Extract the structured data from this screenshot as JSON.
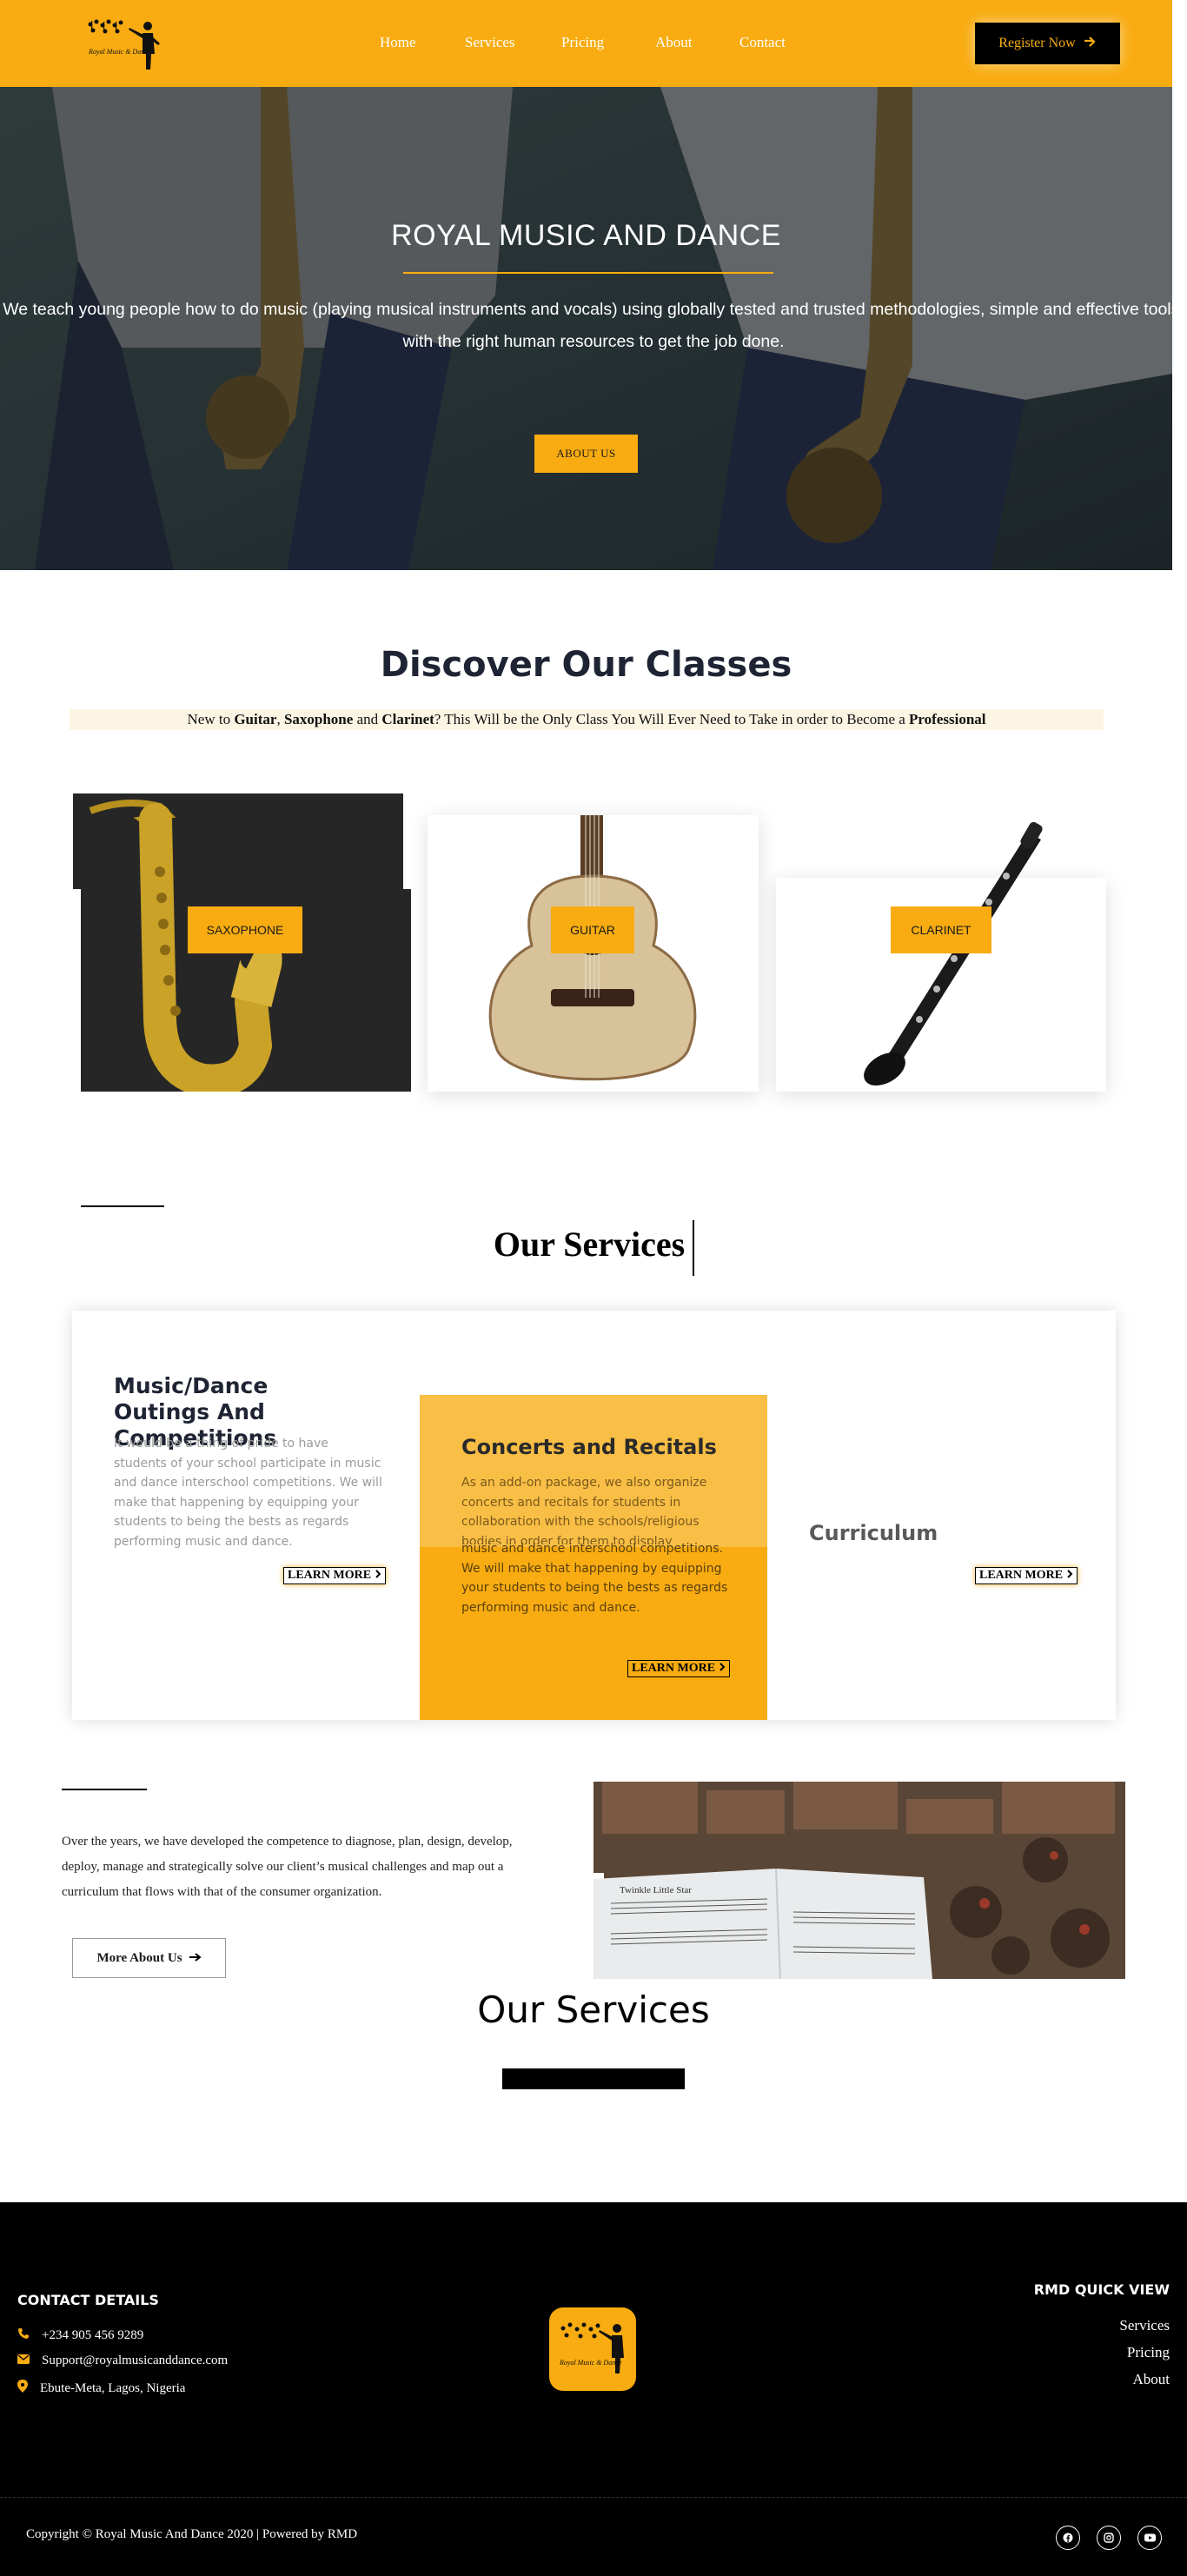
{
  "header": {
    "logo_text": "Royal Music & Dance",
    "nav": [
      "Home",
      "Services",
      "Pricing",
      "About",
      "Contact"
    ],
    "register_label": "Register Now",
    "brand_color": "#f8ac11"
  },
  "hero": {
    "title": "ROYAL MUSIC AND DANCE",
    "text": "We teach young people how to do music (playing musical instruments and vocals) using globally tested and trusted methodologies, simple and effective tools, with the right human resources to get the job done.",
    "button_label": "ABOUT US"
  },
  "discover": {
    "title": "Discover Our Classes",
    "sub_prefix": "New to ",
    "sub_guitar": "Guitar",
    "sub_comma": ", ",
    "sub_sax": "Saxophone",
    "sub_and": " and ",
    "sub_clarinet": "Clarinet",
    "sub_middle": "? This Will be the Only Class You Will Ever Need to Take in order to Become a ",
    "sub_professional": "Professional",
    "classes": [
      {
        "label": "SAXOPHONE"
      },
      {
        "label": "GUITAR"
      },
      {
        "label": "CLARINET"
      }
    ]
  },
  "services": {
    "title": "Our Services",
    "items": [
      {
        "title": "Music/Dance Outings And Competitions",
        "text": "It would be a thing of pride to have students of your school participate in music and dance interschool competitions. We will make that happening by equipping your students to being the bests as regards performing music and dance.",
        "learn": "LEARN MORE"
      },
      {
        "title": "Concerts and Recitals",
        "text": "As an add-on package, we also organize concerts and recitals for students in collaboration with the schools/religious bodies in order for them to display",
        "text_overlap": "music and dance interschool competitions. We will make that happening by equipping your students to being the bests as regards performing music and dance.",
        "learn": "LEARN MORE"
      },
      {
        "title": "Curriculum",
        "learn": "LEARN MORE"
      }
    ]
  },
  "about": {
    "text": "Over the years, we have developed the competence to diagnose, plan, design, develop, deploy, manage and strategically solve our client’s musical challenges and map out a curriculum that flows with that of the consumer organization.",
    "button_label": "More About Us",
    "sheet_title": "Twinkle Little Star"
  },
  "services2": {
    "title": "Our Services"
  },
  "footer": {
    "contact_title": "CONTACT DETAILS",
    "phone": "+234 905 456 9289",
    "email": "Support@royalmusicanddance.com",
    "address": "Ebute-Meta, Lagos, Nigeria",
    "quick_title": "RMD QUICK VIEW",
    "quick_links": [
      "Services",
      "Pricing",
      "About"
    ],
    "copyright": "Copyright © Royal Music And Dance 2020 | Powered by RMD",
    "social": [
      "facebook-icon",
      "instagram-icon",
      "youtube-icon"
    ]
  }
}
